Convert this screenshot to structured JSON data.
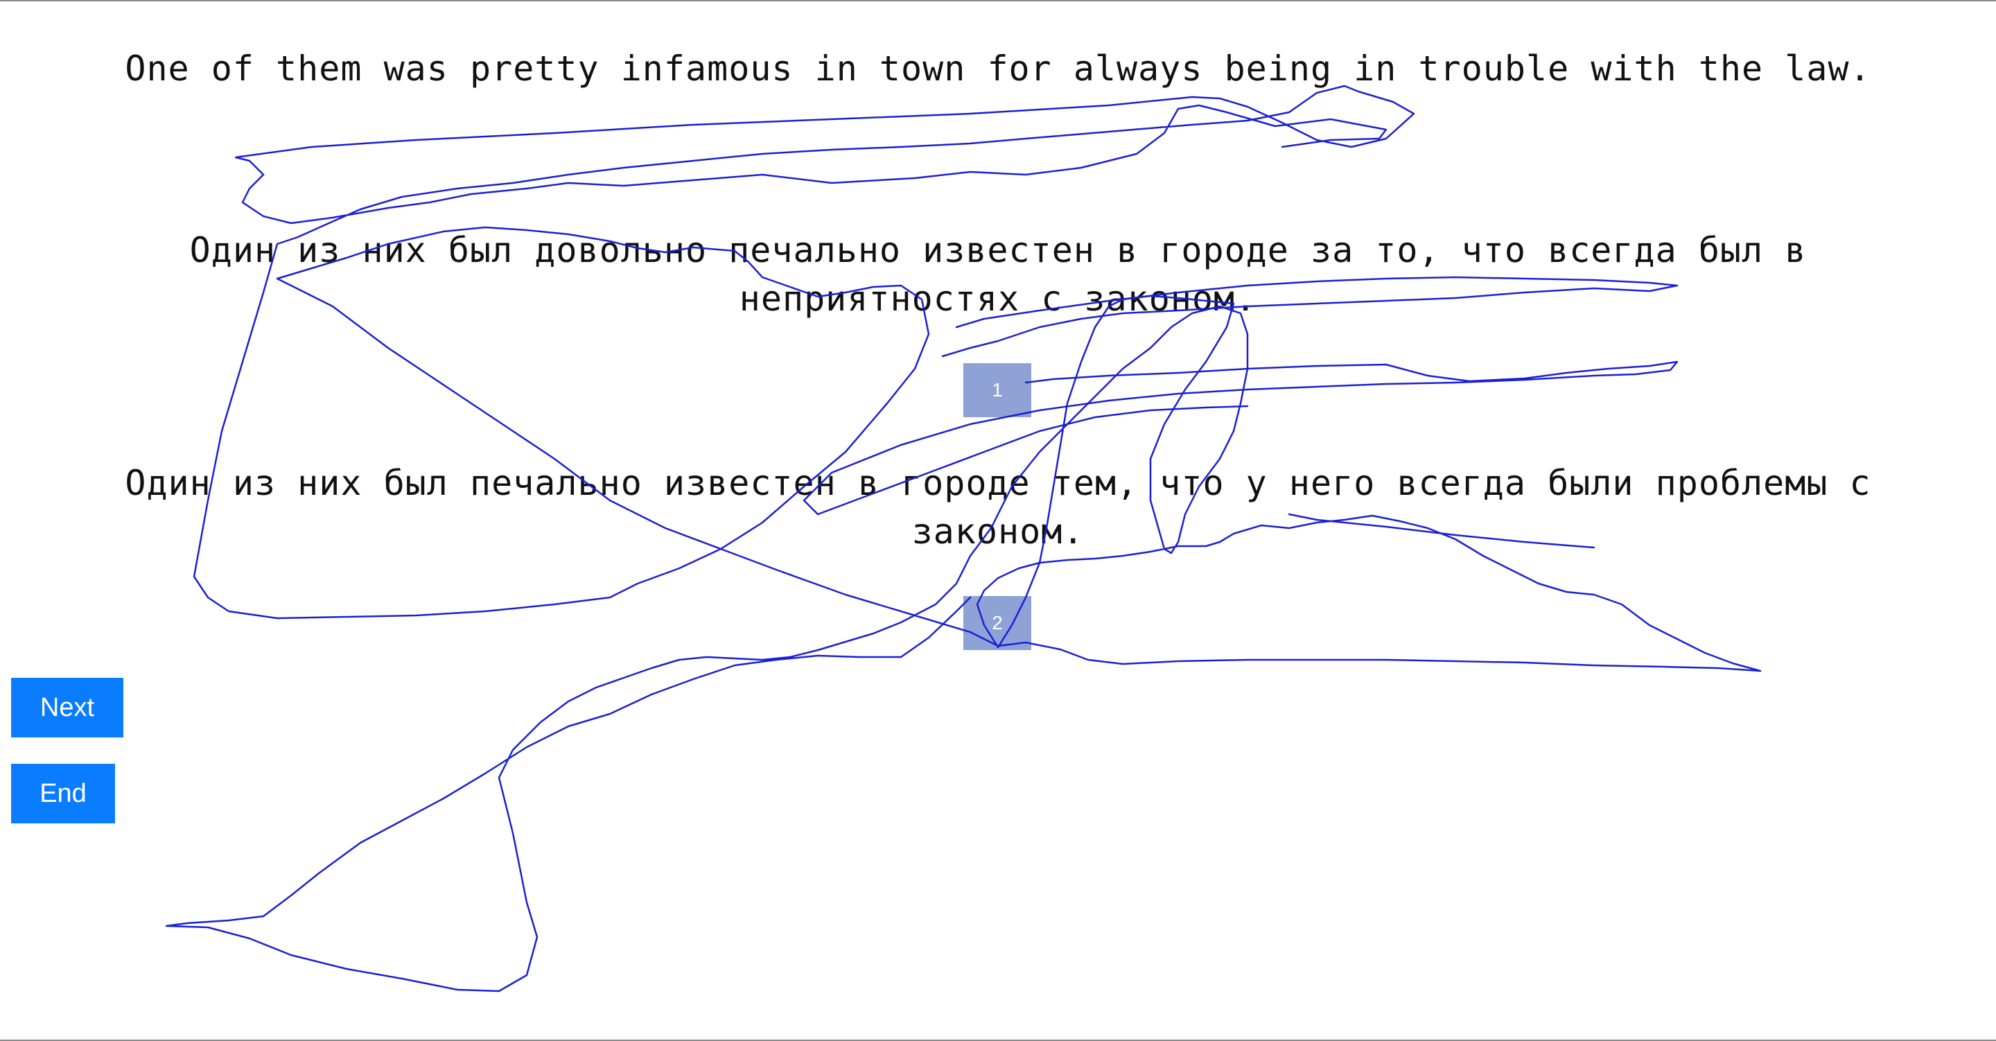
{
  "sentences": {
    "source": "One of them was pretty infamous in town for always being in trouble with the law.",
    "translation_1": "Один из них был довольно печально известен в городе за то, что всегда был в неприятностях с законом.",
    "translation_2": "Один из них был печально известен в городе тем, что у него всегда были проблемы с законом."
  },
  "badges": {
    "first": "1",
    "second": "2"
  },
  "buttons": {
    "next": "Next",
    "end": "End"
  },
  "colors": {
    "button_bg": "#0a7cff",
    "badge_bg": "#8ea2d6",
    "trace": "#1a1fd6"
  },
  "icons": {
    "trace": "mouse-trace-overlay"
  }
}
